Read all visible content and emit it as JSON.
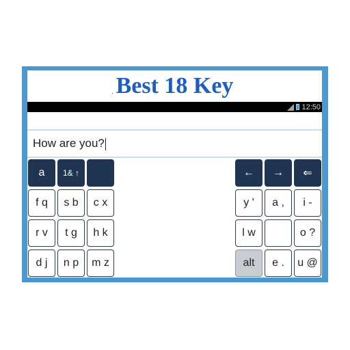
{
  "banner": {
    "title": "Best 18 Key",
    "dot": "."
  },
  "status": {
    "time": "12:50"
  },
  "editor": {
    "text": "How are you?"
  },
  "keyboard": {
    "row1_left": [
      "a",
      "1& ↑",
      ""
    ],
    "row1_right": [
      "←",
      "→",
      "⇐"
    ],
    "row2_left": [
      "f q",
      "s b",
      "c x"
    ],
    "row2_right": [
      "y '",
      "a ,",
      "i -"
    ],
    "row3_left": [
      "r v",
      "t g",
      "h k"
    ],
    "row3_right": [
      "l w",
      "",
      "o ?"
    ],
    "row4_left": [
      "d j",
      "n p",
      "m z"
    ],
    "row4_right": [
      "alt",
      "e .",
      "u @"
    ]
  },
  "colors": {
    "frame": "#4a98cf",
    "title": "#1c5fc4",
    "dark_key": "#1f3552",
    "alt_key": "#c9ccd0"
  }
}
